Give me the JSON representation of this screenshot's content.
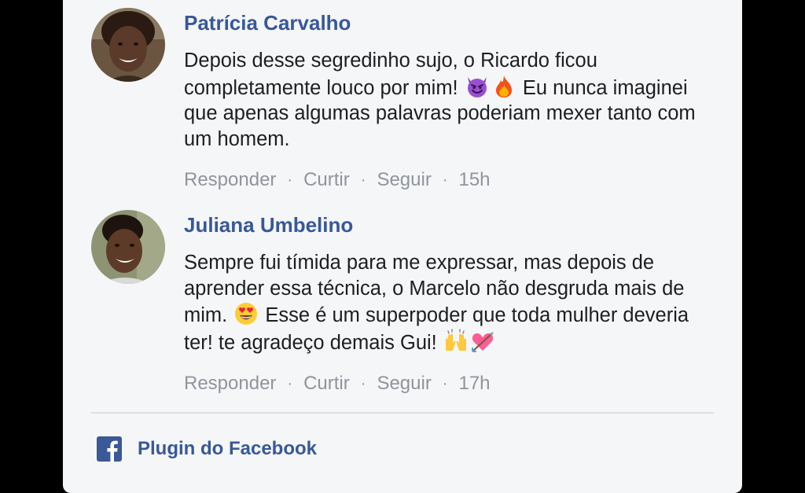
{
  "comments": [
    {
      "author": "Patrícia Carvalho",
      "text_parts": [
        "Depois desse segredinho sujo, o Ricardo ficou completamente louco por mim! ",
        " Eu nunca imaginei que apenas algumas palavras poderiam mexer tanto com um homem."
      ],
      "emojis": [
        "smiling-devil-icon",
        "fire-icon"
      ],
      "actions": {
        "reply": "Responder",
        "like": "Curtir",
        "follow": "Seguir",
        "time": "15h"
      }
    },
    {
      "author": "Juliana Umbelino",
      "text_parts": [
        "Sempre fui tímida para me expressar, mas depois de aprender essa técnica, o Marcelo não desgruda mais de mim. ",
        " Esse é um superpoder que toda mulher deveria ter! te agradeço demais Gui! "
      ],
      "emojis": [
        "heart-eyes-icon",
        "raising-hands-icon",
        "heart-arrow-icon"
      ],
      "actions": {
        "reply": "Responder",
        "like": "Curtir",
        "follow": "Seguir",
        "time": "17h"
      }
    }
  ],
  "footer": {
    "plugin_label": "Plugin do Facebook",
    "icon": "facebook-icon"
  },
  "colors": {
    "author": "#385898",
    "text": "#1c1e21",
    "meta": "#90949c",
    "panel": "#f5f6f7",
    "background": "#000000",
    "facebook_blue": "#3b5998"
  }
}
